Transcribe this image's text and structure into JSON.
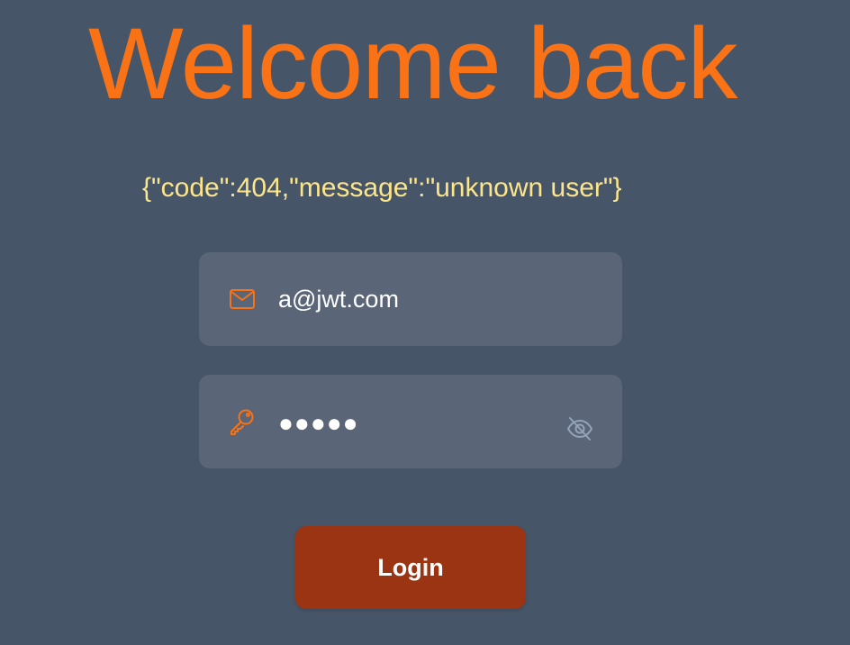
{
  "colors": {
    "background": "#475569",
    "accent": "#f97316",
    "error_text": "#fde68a",
    "field_bg": "#5a6577",
    "button_bg": "#9a3412"
  },
  "heading": {
    "title": "Welcome back"
  },
  "error": {
    "message": "{\"code\":404,\"message\":\"unknown user\"}"
  },
  "form": {
    "email": {
      "value": "a@jwt.com",
      "icon": "envelope-icon"
    },
    "password": {
      "masked_value": "●●●●●",
      "icon": "key-icon",
      "toggle_icon": "eye-off-icon"
    },
    "login_label": "Login"
  }
}
